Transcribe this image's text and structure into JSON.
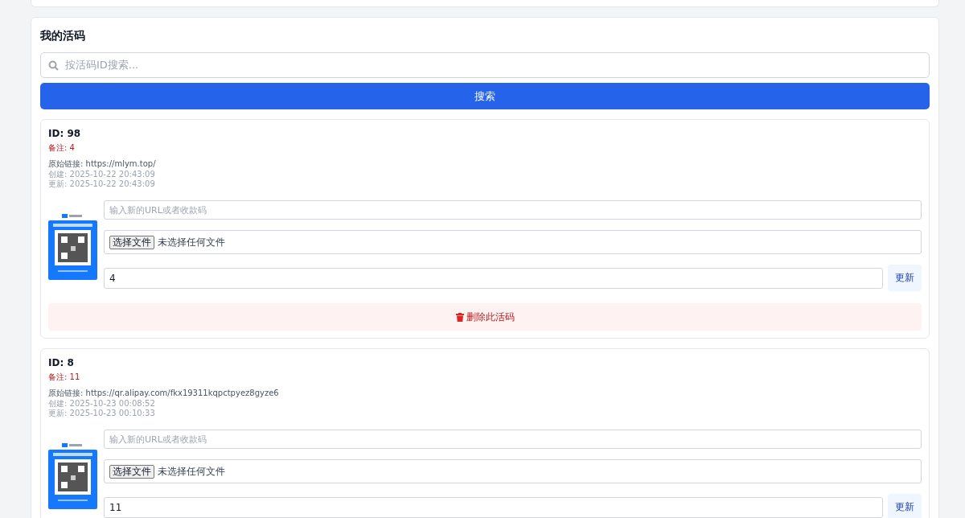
{
  "section": {
    "title": "我的活码",
    "search": {
      "placeholder": "按活码ID搜索..."
    },
    "search_button": "搜索"
  },
  "codes": [
    {
      "id": "ID: 98",
      "note": "备注: 4",
      "original_link": "原始链接: https://mlym.top/",
      "created": "创建: 2025-10-22 20:43:09",
      "updated": "更新: 2025-10-22 20:43:09",
      "url_field": {
        "placeholder": "输入新的URL或者收款码"
      },
      "file_input": {
        "button": "选择文件",
        "status": "未选择任何文件"
      },
      "note_field": {
        "value": "4"
      },
      "update_button": "更新",
      "delete_button": "删除此活码"
    },
    {
      "id": "ID: 8",
      "note": "备注: 11",
      "original_link": "原始链接: https://qr.alipay.com/fkx19311kqpctpyez8gyze6",
      "created": "创建: 2025-10-23 00:08:52",
      "updated": "更新: 2025-10-23 00:10:33",
      "url_field": {
        "placeholder": "输入新的URL或者收款码"
      },
      "file_input": {
        "button": "选择文件",
        "status": "未选择任何文件"
      },
      "note_field": {
        "value": "11"
      },
      "update_button": "更新"
    }
  ]
}
